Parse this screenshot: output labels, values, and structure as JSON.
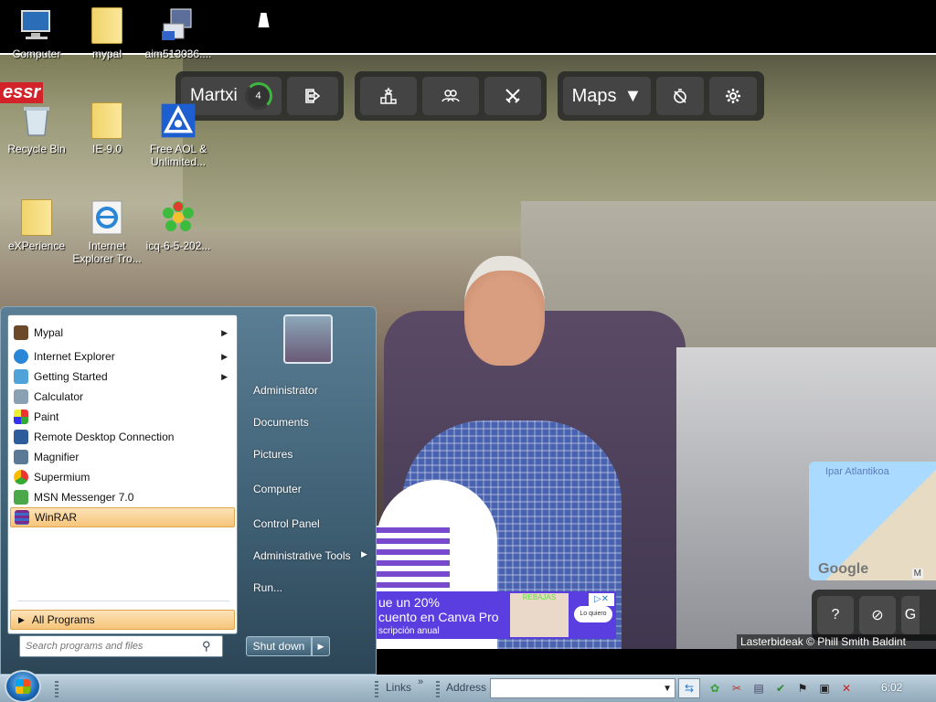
{
  "desktop": {
    "icons": [
      {
        "label": "Computer"
      },
      {
        "label": "mypal"
      },
      {
        "label": "aim513036...."
      },
      {
        "label": "Recycle Bin"
      },
      {
        "label": "IE-9.0"
      },
      {
        "label": "Free AOL & Unlimited..."
      },
      {
        "label": "eXPerience"
      },
      {
        "label": "Internet Explorer Tro..."
      },
      {
        "label": "icq-6-5-202..."
      }
    ],
    "logo_text": "essr"
  },
  "game": {
    "user": {
      "name": "Martxi",
      "score": "4"
    },
    "maps_label": "Maps",
    "icons": [
      "logout-icon",
      "podium-icon",
      "group-icon",
      "swords-icon",
      "timer-off-icon",
      "settings-icon"
    ],
    "minimap": {
      "label": "Ipar Atlantikoa",
      "brand": "Google",
      "kb_label": "M"
    },
    "bottom_controls": {
      "help": "?",
      "partial": "G"
    },
    "credits": "Lasterbideak  © Phill Smith   Baldint"
  },
  "ad": {
    "line1": "ue un 20%",
    "line2": "cuento en Canva Pro",
    "line3": "scripción anual",
    "brand": "REBAJAS",
    "cta": "Lo quiero"
  },
  "start_menu": {
    "programs": [
      {
        "label": "Mypal",
        "has_arrow": true
      },
      {
        "label": "Internet Explorer",
        "has_arrow": true
      },
      {
        "label": "Getting Started",
        "has_arrow": true
      },
      {
        "label": "Calculator",
        "has_arrow": false
      },
      {
        "label": "Paint",
        "has_arrow": false
      },
      {
        "label": "Remote Desktop Connection",
        "has_arrow": false
      },
      {
        "label": "Magnifier",
        "has_arrow": false
      },
      {
        "label": "Supermium",
        "has_arrow": false
      },
      {
        "label": "MSN Messenger 7.0",
        "has_arrow": false
      },
      {
        "label": "WinRAR",
        "has_arrow": false
      }
    ],
    "all_programs": "All Programs",
    "search_placeholder": "Search programs and files",
    "right_items": [
      {
        "label": "Administrator"
      },
      {
        "label": "Documents"
      },
      {
        "label": "Pictures"
      },
      {
        "label": "Computer"
      },
      {
        "label": "Control Panel"
      },
      {
        "label": "Administrative Tools"
      },
      {
        "label": "Run..."
      }
    ],
    "shutdown_label": "Shut down"
  },
  "taskbar": {
    "links_label": "Links",
    "address_label": "Address",
    "address_value": "",
    "clock": "6:02"
  },
  "colors": {
    "accent_highlight": "#f6c47a",
    "start_menu_bg": "#3e5e72",
    "taskbar_bg": "#a6bccb"
  }
}
